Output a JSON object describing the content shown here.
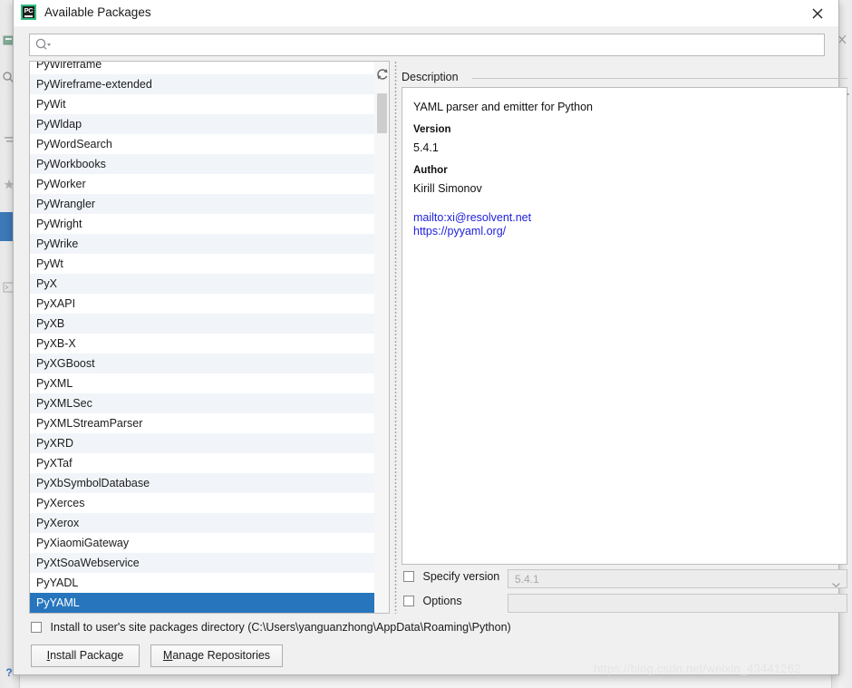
{
  "window": {
    "title": "Available Packages",
    "icon": "pycharm-icon",
    "close_label": "×"
  },
  "search": {
    "value": "",
    "placeholder": "",
    "icon": "search-icon"
  },
  "toolbar": {
    "refresh_icon": "refresh-icon"
  },
  "package_list": {
    "selected": "PyYAML",
    "items": [
      "PyWireframe",
      "PyWireframe-extended",
      "PyWit",
      "PyWldap",
      "PyWordSearch",
      "PyWorkbooks",
      "PyWorker",
      "PyWrangler",
      "PyWright",
      "PyWrike",
      "PyWt",
      "PyX",
      "PyXAPI",
      "PyXB",
      "PyXB-X",
      "PyXGBoost",
      "PyXML",
      "PyXMLSec",
      "PyXMLStreamParser",
      "PyXRD",
      "PyXTaf",
      "PyXbSymbolDatabase",
      "PyXerces",
      "PyXerox",
      "PyXiaomiGateway",
      "PyXtSoaWebservice",
      "PyYADL",
      "PyYAML"
    ]
  },
  "description": {
    "group_label": "Description",
    "summary": "YAML parser and emitter for Python",
    "version_label": "Version",
    "version_value": "5.4.1",
    "author_label": "Author",
    "author_value": "Kirill Simonov",
    "links": [
      "mailto:xi@resolvent.net",
      "https://pyyaml.org/"
    ]
  },
  "options": {
    "specify_version_label": "Specify version",
    "specify_version_checked": false,
    "specify_version_value": "5.4.1",
    "options_label": "Options",
    "options_checked": false,
    "options_value": "",
    "install_user_dir_label": "Install to user's site packages directory (C:\\Users\\yanguanzhong\\AppData\\Roaming\\Python)",
    "install_user_dir_checked": false
  },
  "buttons": {
    "install_mnemonic": "I",
    "install_rest": "nstall Package",
    "manage_mnemonic": "M",
    "manage_rest": "anage Repositories"
  },
  "watermark": {
    "text": "https://blog.csdn.net/weixin_43441262"
  },
  "colors": {
    "selection_blue": "#2776bd",
    "link_blue": "#2020dd",
    "row_alt": "#f1f5f9",
    "dialog_bg": "#f0f0f0"
  }
}
